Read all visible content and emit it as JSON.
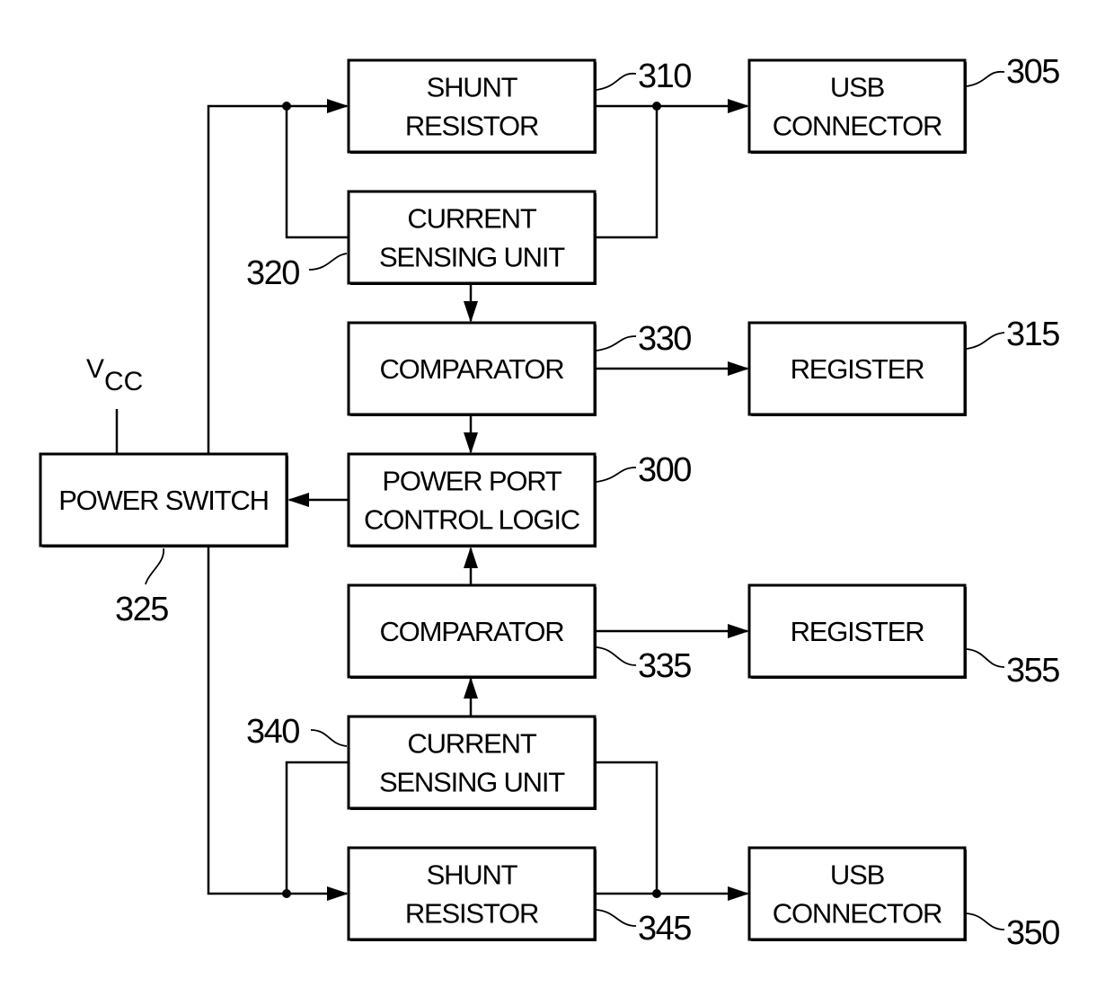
{
  "diagram": {
    "blocks": [
      {
        "id": "shunt_top",
        "lines": [
          "SHUNT",
          "RESISTOR"
        ],
        "ref": "310"
      },
      {
        "id": "usb_top",
        "lines": [
          "USB",
          "CONNECTOR"
        ],
        "ref": "305"
      },
      {
        "id": "csu_top",
        "lines": [
          "CURRENT",
          "SENSING UNIT"
        ],
        "ref": "320"
      },
      {
        "id": "comp_top",
        "lines": [
          "COMPARATOR"
        ],
        "ref": "330"
      },
      {
        "id": "reg_top",
        "lines": [
          "REGISTER"
        ],
        "ref": "315"
      },
      {
        "id": "power_switch",
        "lines": [
          "POWER SWITCH"
        ],
        "ref": "325"
      },
      {
        "id": "ppcl",
        "lines": [
          "POWER PORT",
          "CONTROL LOGIC"
        ],
        "ref": "300"
      },
      {
        "id": "comp_bot",
        "lines": [
          "COMPARATOR"
        ],
        "ref": "335"
      },
      {
        "id": "reg_bot",
        "lines": [
          "REGISTER"
        ],
        "ref": "355"
      },
      {
        "id": "csu_bot",
        "lines": [
          "CURRENT",
          "SENSING UNIT"
        ],
        "ref": "340"
      },
      {
        "id": "shunt_bot",
        "lines": [
          "SHUNT",
          "RESISTOR"
        ],
        "ref": "345"
      },
      {
        "id": "usb_bot",
        "lines": [
          "USB",
          "CONNECTOR"
        ],
        "ref": "350"
      }
    ],
    "supply": {
      "main": "V",
      "sub": "CC"
    }
  }
}
